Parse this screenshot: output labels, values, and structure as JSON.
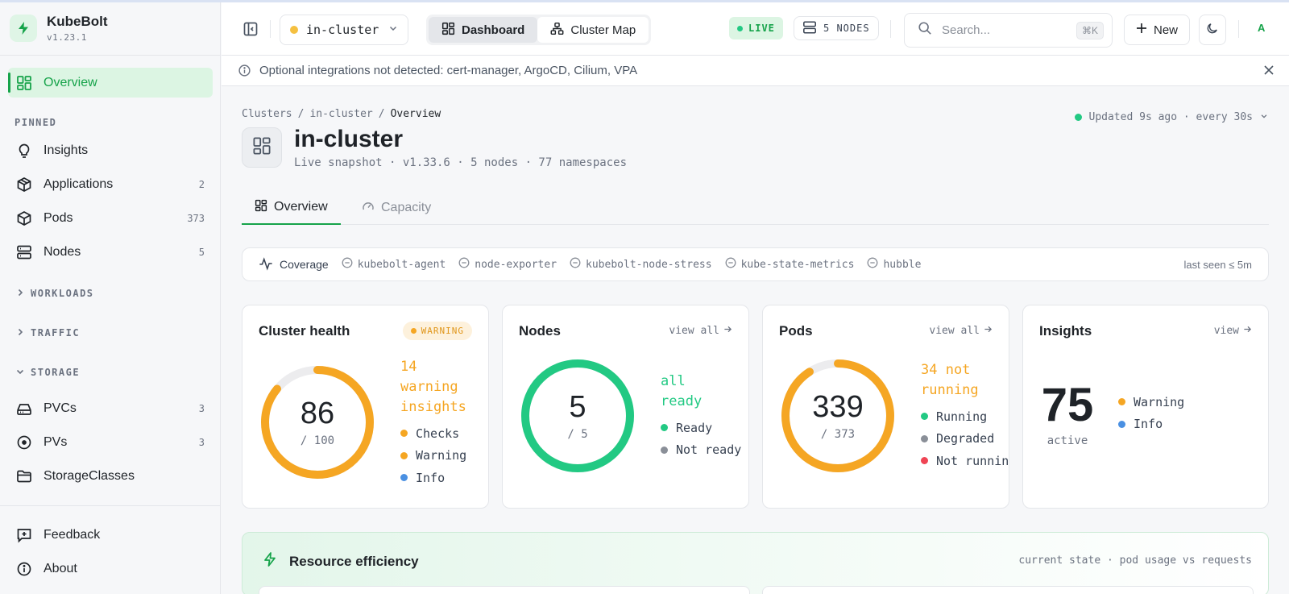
{
  "brand": {
    "name": "KubeBolt",
    "version": "v1.23.1"
  },
  "sidebar": {
    "overview": "Overview",
    "pinned_label": "PINNED",
    "pinned": [
      {
        "label": "Insights",
        "count": "",
        "icon": "lightbulb-icon"
      },
      {
        "label": "Applications",
        "count": "2",
        "icon": "box-icon"
      },
      {
        "label": "Pods",
        "count": "373",
        "icon": "cube-icon"
      },
      {
        "label": "Nodes",
        "count": "5",
        "icon": "server-icon"
      }
    ],
    "workloads": "WORKLOADS",
    "traffic": "TRAFFIC",
    "storage": "STORAGE",
    "storage_items": [
      {
        "label": "PVCs",
        "count": "3",
        "icon": "drive-icon"
      },
      {
        "label": "PVs",
        "count": "3",
        "icon": "disc-icon"
      },
      {
        "label": "StorageClasses",
        "count": "",
        "icon": "folder-icon"
      }
    ],
    "feedback": "Feedback",
    "about": "About"
  },
  "topbar": {
    "cluster": "in-cluster",
    "tabs": [
      "Dashboard",
      "Cluster Map"
    ],
    "live": "LIVE",
    "nodes": "5 NODES",
    "search_placeholder": "Search...",
    "shortcut": "⌘K",
    "new": "New",
    "avatar": "A"
  },
  "banner": {
    "text": "Optional integrations not detected: cert-manager, ArgoCD, Cilium, VPA"
  },
  "breadcrumb": [
    "Clusters",
    "in-cluster",
    "Overview"
  ],
  "updated": "Updated 9s ago · every 30s",
  "page": {
    "title": "in-cluster",
    "subtitle": "Live snapshot · v1.33.6 · 5 nodes · 77 namespaces",
    "tabs": [
      "Overview",
      "Capacity"
    ]
  },
  "coverage": {
    "label": "Coverage",
    "items": [
      "kubebolt-agent",
      "node-exporter",
      "kubebolt-node-stress",
      "kube-state-metrics",
      "hubble"
    ],
    "last_seen": "last seen ≤ 5m"
  },
  "cards": {
    "health": {
      "title": "Cluster health",
      "badge": "WARNING",
      "value": "86",
      "total": "/ 100",
      "fraction": 0.86,
      "headline": [
        "14",
        "warning",
        "insights"
      ],
      "legend": [
        {
          "label": "Checks",
          "color": "#f5a623"
        },
        {
          "label": "Warning",
          "color": "#f5a623"
        },
        {
          "label": "Info",
          "color": "#4a90e2"
        }
      ]
    },
    "nodes": {
      "title": "Nodes",
      "link": "view all",
      "value": "5",
      "total": "/ 5",
      "fraction": 1.0,
      "headline": [
        "all",
        "ready"
      ],
      "legend": [
        {
          "label": "Ready",
          "color": "#22c983"
        },
        {
          "label": "Not ready",
          "color": "#8a8f98"
        }
      ]
    },
    "pods": {
      "title": "Pods",
      "link": "view all",
      "value": "339",
      "total": "/ 373",
      "fraction": 0.909,
      "headline": [
        "34 not",
        "running"
      ],
      "legend": [
        {
          "label": "Running",
          "color": "#22c983"
        },
        {
          "label": "Degraded",
          "color": "#8a8f98"
        },
        {
          "label": "Not running",
          "color": "#ef4454"
        }
      ]
    },
    "insights": {
      "title": "Insights",
      "link": "view",
      "value": "75",
      "sub": "active",
      "legend": [
        {
          "label": "Warning",
          "color": "#f5a623"
        },
        {
          "label": "Info",
          "color": "#4a90e2"
        }
      ]
    }
  },
  "efficiency": {
    "title": "Resource efficiency",
    "note": "current state · pod usage vs requests"
  },
  "colors": {
    "accent": "#16a34a",
    "warning": "#f5a623",
    "ready": "#22c983",
    "info": "#4a90e2",
    "error": "#ef4454"
  }
}
